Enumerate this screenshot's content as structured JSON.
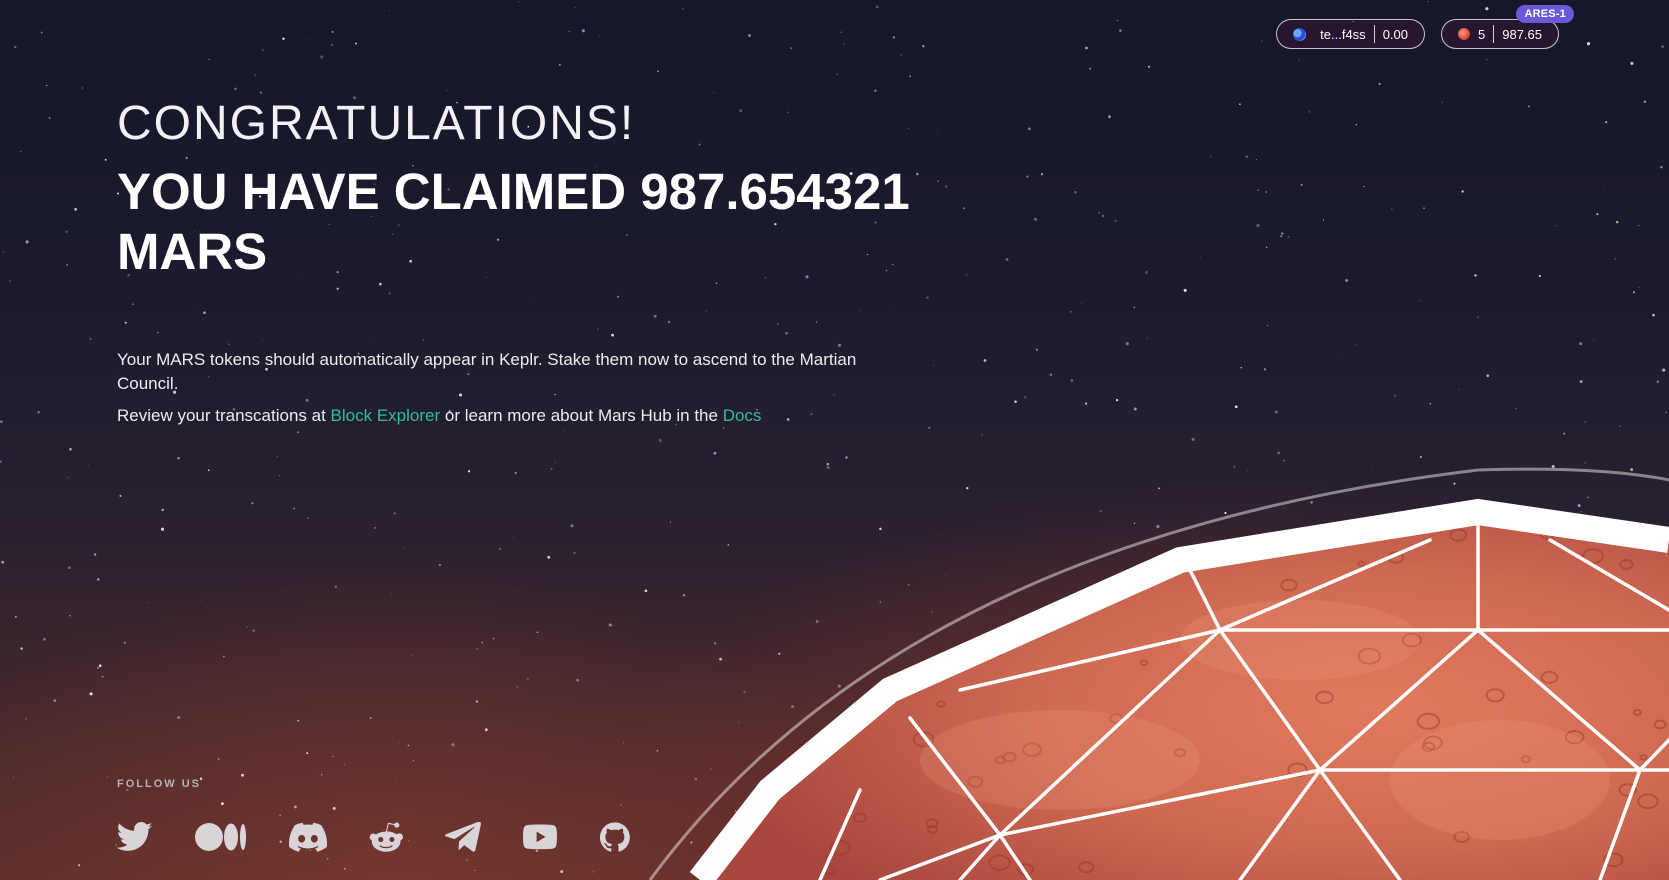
{
  "header": {
    "wallet": {
      "address": "te...f4ss",
      "balance": "0.00",
      "icon": "wallet-globe-icon"
    },
    "mars": {
      "count": "5",
      "balance": "987.65",
      "icon": "mars-planet-icon",
      "network_badge": "ARES-1"
    }
  },
  "main": {
    "congrats": "CONGRATULATIONS!",
    "claimed": "YOU HAVE CLAIMED 987.654321 MARS",
    "description": "Your MARS tokens should automatically appear in Keplr. Stake them now to ascend to the Martian Council.",
    "review_prefix": "Review your transcations at ",
    "block_explorer_link": "Block Explorer",
    "review_middle": " or learn more about Mars Hub in the ",
    "docs_link": "Docs"
  },
  "footer": {
    "follow_label": "FOLLOW US",
    "socials": [
      {
        "name": "twitter",
        "icon": "twitter-icon"
      },
      {
        "name": "medium",
        "icon": "medium-icon"
      },
      {
        "name": "discord",
        "icon": "discord-icon"
      },
      {
        "name": "reddit",
        "icon": "reddit-icon"
      },
      {
        "name": "telegram",
        "icon": "telegram-icon"
      },
      {
        "name": "youtube",
        "icon": "youtube-icon"
      },
      {
        "name": "github",
        "icon": "github-icon"
      }
    ]
  },
  "colors": {
    "link": "#2ebf9a",
    "badge": "#6a59d8",
    "planet": "#d2664f"
  }
}
